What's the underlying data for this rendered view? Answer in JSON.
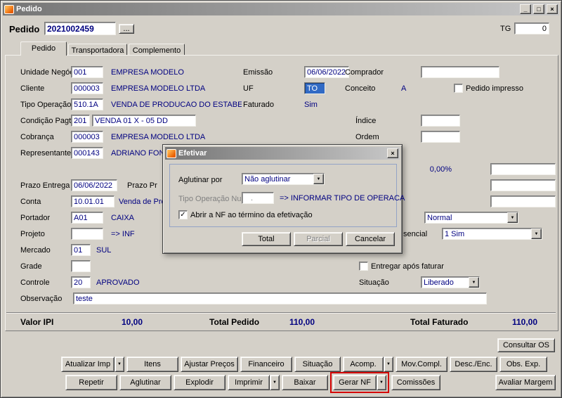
{
  "icons": {
    "minimize": "_",
    "maximize": "□",
    "close": "×",
    "dropdown": "▼",
    "check": "✓",
    "lookup": "..."
  },
  "window": {
    "title": "Pedido"
  },
  "header": {
    "pedido_label": "Pedido",
    "pedido_value": "2021002459",
    "tg_label": "TG",
    "tg_value": "0"
  },
  "tabs": {
    "pedido": "Pedido",
    "transportadora": "Transportadora",
    "complemento": "Complemento"
  },
  "form": {
    "unidade_label": "Unidade Negócio",
    "unidade_code": "001",
    "unidade_desc": "EMPRESA MODELO",
    "emissao_label": "Emissão",
    "emissao_value": "06/06/2022",
    "comprador_label": "Comprador",
    "comprador_value": "",
    "cliente_label": "Cliente",
    "cliente_code": "000003",
    "cliente_desc": "EMPRESA MODELO LTDA",
    "uf_label": "UF",
    "uf_value": "TO",
    "conceito_label": "Conceito",
    "conceito_value": "A",
    "pedido_impresso_label": "Pedido impresso",
    "tipo_op_label": "Tipo Operação",
    "tipo_op_code": "510.1A",
    "tipo_op_desc": "VENDA DE PRODUCAO DO ESTABELECIMEI",
    "faturado_label": "Faturado",
    "faturado_value": "Sim",
    "cond_pagto_label": "Condição Pagto.",
    "cond_pagto_code": "201",
    "cond_pagto_desc": "VENDA 01 X - 05 DD",
    "indice_label": "Índice",
    "indice_value": "",
    "cobranca_label": "Cobrança",
    "cobranca_code": "000003",
    "cobranca_desc": "EMPRESA MODELO LTDA",
    "ordem_label": "Ordem",
    "ordem_value": "",
    "representante_label": "Representante",
    "representante_code": "000143",
    "representante_desc": "ADRIANO FONSI",
    "percent_value": "0,00%",
    "prazo_entrega_label": "Prazo Entrega",
    "prazo_entrega_value": "06/06/2022",
    "prazo_pr_label": "Prazo Pr",
    "conta_label": "Conta",
    "conta_code": "10.01.01",
    "conta_desc": "Venda de Pro",
    "portador_label": "Portador",
    "portador_code": "A01",
    "portador_desc": "CAIXA",
    "tipo_frete_value": "Normal",
    "projeto_label": "Projeto",
    "projeto_value": "",
    "projeto_hint": "=> INF",
    "presencial_label": "sencial",
    "presencial_value": "1 Sim",
    "mercado_label": "Mercado",
    "mercado_code": "01",
    "mercado_desc": "SUL",
    "grade_label": "Grade",
    "grade_value": "",
    "entregar_label": "Entregar após faturar",
    "controle_label": "Controle",
    "controle_code": "20",
    "controle_desc": "APROVADO",
    "situacao_label": "Situação",
    "situacao_value": "Liberado",
    "observacao_label": "Observação",
    "observacao_value": "teste"
  },
  "totals": {
    "valor_ipi_label": "Valor IPI",
    "valor_ipi_value": "10,00",
    "total_pedido_label": "Total Pedido",
    "total_pedido_value": "110,00",
    "total_faturado_label": "Total Faturado",
    "total_faturado_value": "110,00"
  },
  "actions": {
    "consultar_os": "Consultar OS",
    "atualizar_imp": "Atualizar Imp",
    "itens": "Itens",
    "ajustar_precos": "Ajustar Preços",
    "financeiro": "Financeiro",
    "situacao": "Situação",
    "acomp": "Acomp.",
    "mov_compl": "Mov.Compl.",
    "desc_enc": "Desc./Enc.",
    "obs_exp": "Obs. Exp.",
    "repetir": "Repetir",
    "aglutinar": "Aglutinar",
    "explodir": "Explodir",
    "imprimir": "Imprimir",
    "baixar": "Baixar",
    "gerar_nf": "Gerar NF",
    "comissoes": "Comissões",
    "avaliar_margem": "Avaliar Margem"
  },
  "dialog": {
    "title": "Efetivar",
    "aglutinar_label": "Aglutinar por",
    "aglutinar_value": "Não aglutinar",
    "tipo_nulo_label": "Tipo Operação Nulo",
    "tipo_nulo_value": ".",
    "tipo_nulo_hint": "=> INFORMAR TIPO DE OPERACA",
    "abrir_nf_label": "Abrir a NF ao término da efetivação",
    "total_button": "Total",
    "parcial_button": "Parcial",
    "cancelar_button": "Cancelar"
  },
  "colors": {
    "value_text": "#000080",
    "highlight_border": "#d40000"
  }
}
